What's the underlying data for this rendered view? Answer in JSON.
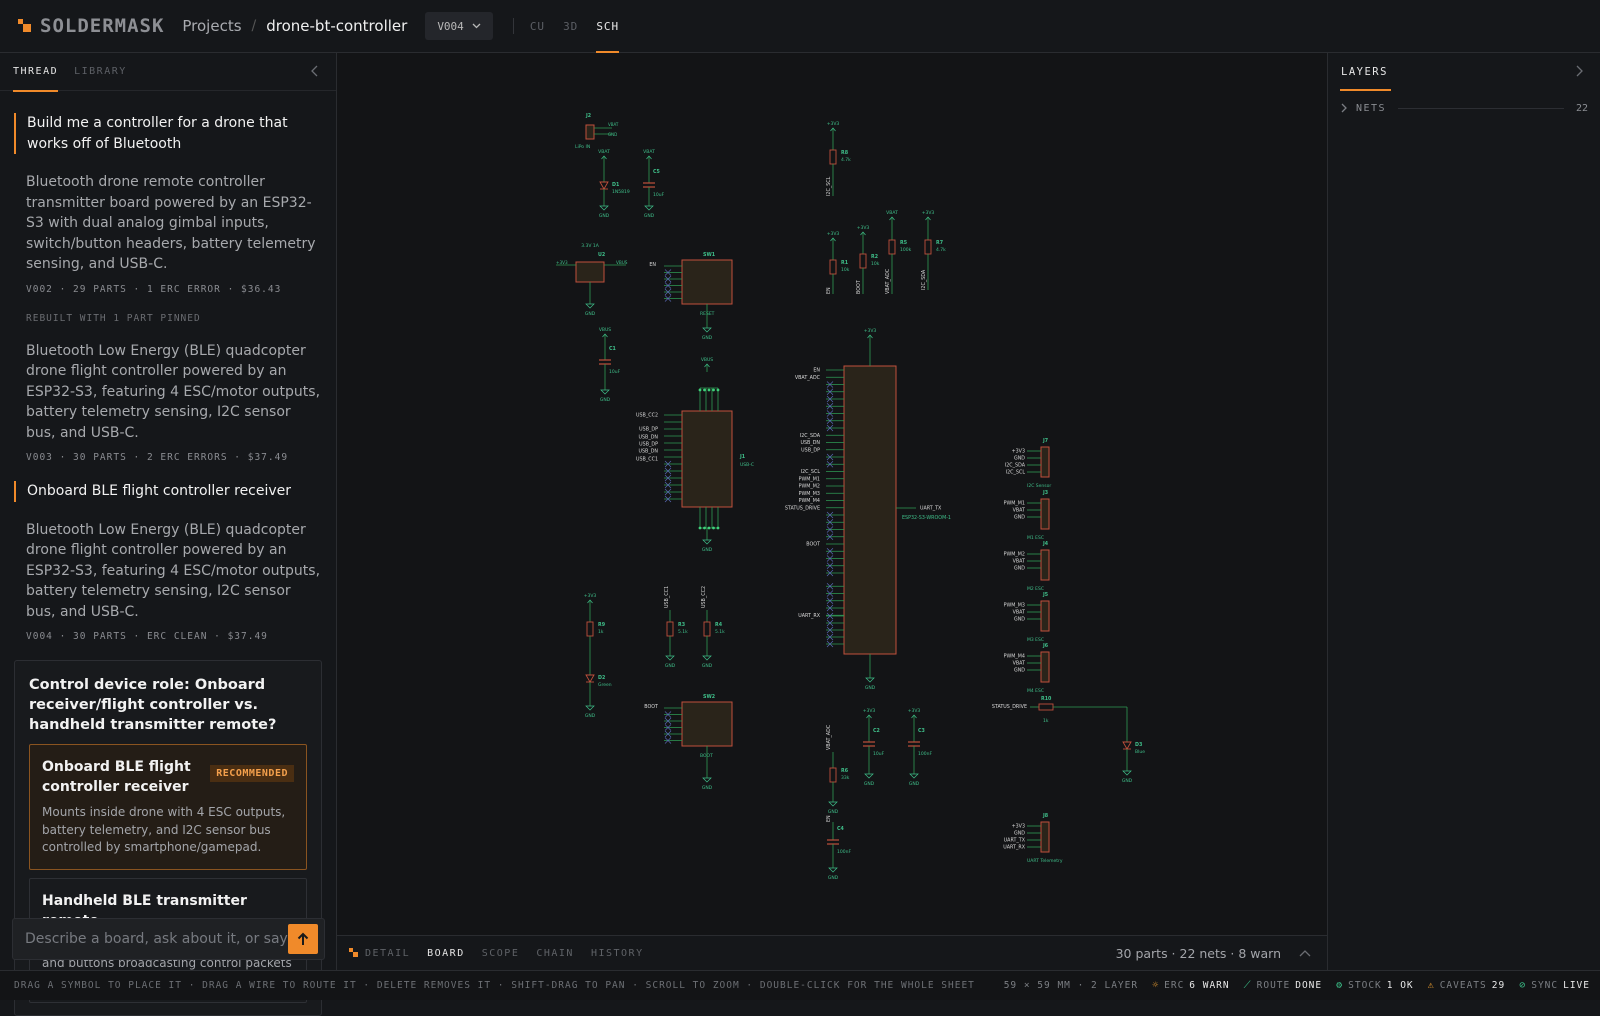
{
  "app": {
    "logo_text": "SOLDERMASK",
    "breadcrumb_projects": "Projects",
    "breadcrumb_sep": "/",
    "project_name": "drone-bt-controller",
    "version": "V004",
    "view_tabs": [
      "CU",
      "3D",
      "SCH"
    ],
    "active_view": "SCH"
  },
  "left_panel": {
    "tabs": [
      "THREAD",
      "LIBRARY"
    ],
    "active_tab": "THREAD",
    "thread": [
      {
        "role": "user",
        "text": "Build me a controller for a drone that works off of Bluetooth"
      },
      {
        "role": "ai",
        "text": "Bluetooth drone remote controller transmitter board powered by an ESP32-S3 with dual analog gimbal inputs, switch/button headers, battery telemetry sensing, and USB-C.",
        "meta": "V002  ·  29 PARTS  ·  1 ERC ERROR  ·  $36.43"
      },
      {
        "role": "note",
        "text": "REBUILT WITH 1 PART PINNED"
      },
      {
        "role": "ai",
        "text": "Bluetooth Low Energy (BLE) quadcopter drone flight controller powered by an ESP32-S3, featuring 4 ESC/motor outputs, battery telemetry sensing, I2C sensor bus, and USB-C.",
        "meta": "V003  ·  30 PARTS  ·  2 ERC ERRORS  ·  $37.49"
      },
      {
        "role": "user",
        "text": "Onboard BLE flight controller receiver"
      },
      {
        "role": "ai",
        "text": "Bluetooth Low Energy (BLE) quadcopter drone flight controller powered by an ESP32-S3, featuring 4 ESC/motor outputs, battery telemetry sensing, I2C sensor bus, and USB-C.",
        "meta": "V004  ·  30 PARTS  ·  ERC CLEAN  ·  $37.49"
      }
    ],
    "question": {
      "title": "Control device role: Onboard receiver/flight controller vs. handheld transmitter remote?",
      "options": [
        {
          "title": "Onboard BLE flight controller receiver",
          "badge": "RECOMMENDED",
          "desc": "Mounts inside drone with 4 ESC outputs, battery telemetry, and I2C sensor bus controlled by smartphone/gamepad."
        },
        {
          "title": "Handheld BLE transmitter remote",
          "badge": "",
          "desc": "Handheld unit with dual analog joysticks and buttons broadcasting control packets to drone."
        }
      ]
    },
    "composer_placeholder": "Describe a board, ask about it, or say what to change"
  },
  "canvas_bottom": {
    "tabs": [
      "DETAIL",
      "BOARD",
      "SCOPE",
      "CHAIN",
      "HISTORY"
    ],
    "active_tab": "BOARD",
    "summary": "30 parts · 22 nets · 8 warn"
  },
  "right_panel": {
    "tab": "LAYERS",
    "nets_label": "NETS",
    "nets_count": "22"
  },
  "schematic": {
    "colors": {
      "part_fill": "#2a241a",
      "part_stroke": "#c0503c",
      "wire": "#2f9a55",
      "label": "#3fbf8a",
      "text": "#d8d8d8",
      "gnd": "#3fbf8a"
    },
    "mcu": {
      "ref": "U1",
      "value": "ESP32-S3-WROOM-1",
      "power": "+3V3",
      "gnd": "GND",
      "tx_net": "UART_TX",
      "left_nets": [
        "EN",
        "VBAT_ADC",
        "",
        "",
        "",
        "",
        "",
        "",
        "",
        "I2C_SDA",
        "USB_DN",
        "USB_DP",
        "",
        "",
        "I2C_SCL",
        "PWM_M1",
        "PWM_M2",
        "PWM_M3",
        "PWM_M4",
        "STATUS_DRIVE",
        "",
        "",
        "",
        "",
        "BOOT",
        "",
        "",
        "",
        "",
        "",
        "",
        "",
        "",
        "UART_RX"
      ]
    },
    "labels": {
      "J2": "J2",
      "J2_val": "LiPo IN",
      "VBAT": "VBAT",
      "GND": "GND",
      "D1": "D1",
      "D1_val": "1N5819",
      "C5": "C5",
      "C5_val": "10uF",
      "U2": "U2",
      "U2_val": "3.3V 1A",
      "V3V3": "+3V3",
      "VBUS": "VBUS",
      "EN": "EN",
      "SW1": "SW1",
      "SW1_val": "RESET",
      "C1": "C1",
      "C1_val": "10uF",
      "J1": "J1",
      "J1_val": "USB-C",
      "USB_CC2": "USB_CC2",
      "USB_DP": "USB_DP",
      "USB_DN": "USB_DN",
      "USB_CC1": "USB_CC1",
      "R8": "R8",
      "R8_val": "4.7k",
      "I2C_SCL": "I2C_SCL",
      "R1": "R1",
      "R1_val": "10k",
      "R2": "R2",
      "R2_val": "10k",
      "BOOT": "BOOT",
      "R5": "R5",
      "R5_val": "100k",
      "VBAT_ADC": "VBAT_ADC",
      "R7": "R7",
      "R7_val": "4.7k",
      "I2C_SDA": "I2C_SDA",
      "R9": "R9",
      "R9_val": "1k",
      "D2": "D2",
      "D2_val": "Green",
      "R3": "R3",
      "R3_val": "5.1k",
      "R4": "R4",
      "R4_val": "5.1k",
      "USB_CC1v": "USB_CC1",
      "USB_CC2v": "USB_CC2",
      "SW2": "SW2",
      "SW2_val": "BOOT",
      "C2": "C2",
      "C2_val": "10uF",
      "C3": "C3",
      "C3_val": "100nF",
      "R6": "R6",
      "R6_val": "33k",
      "C4": "C4",
      "C4_val": "100nF",
      "J7": "J7",
      "J7_val": "I2C Sensor",
      "J3": "J3",
      "J3_val": "M1 ESC",
      "J4": "J4",
      "J4_val": "M2 ESC",
      "J5": "J5",
      "J5_val": "M3 ESC",
      "J6": "J6",
      "J6_val": "M4 ESC",
      "PWM_M1": "PWM_M1",
      "PWM_M2": "PWM_M2",
      "PWM_M3": "PWM_M3",
      "PWM_M4": "PWM_M4",
      "STATUS_DRIVE": "STATUS_DRIVE",
      "R10": "R10",
      "R10_val": "1k",
      "D3": "D3",
      "D3_val": "Blue",
      "J8": "J8",
      "J8_val": "UART Telemetry",
      "UART_TX": "UART_TX",
      "UART_RX": "UART_RX"
    }
  },
  "statusbar": {
    "hint": "DRAG A SYMBOL TO PLACE IT · DRAG A WIRE TO ROUTE IT · DELETE REMOVES IT · SHIFT-DRAG TO PAN · SCROLL TO ZOOM · DOUBLE-CLICK FOR THE WHOLE SHEET",
    "board_size": "59 × 59 MM · 2 LAYER",
    "erc_label": "ERC",
    "erc_value": "6 WARN",
    "route_label": "ROUTE",
    "route_value": "DONE",
    "stock_label": "STOCK",
    "stock_value": "1 OK",
    "caveats_label": "CAVEATS",
    "caveats_value": "29",
    "sync_label": "SYNC",
    "sync_value": "LIVE"
  }
}
